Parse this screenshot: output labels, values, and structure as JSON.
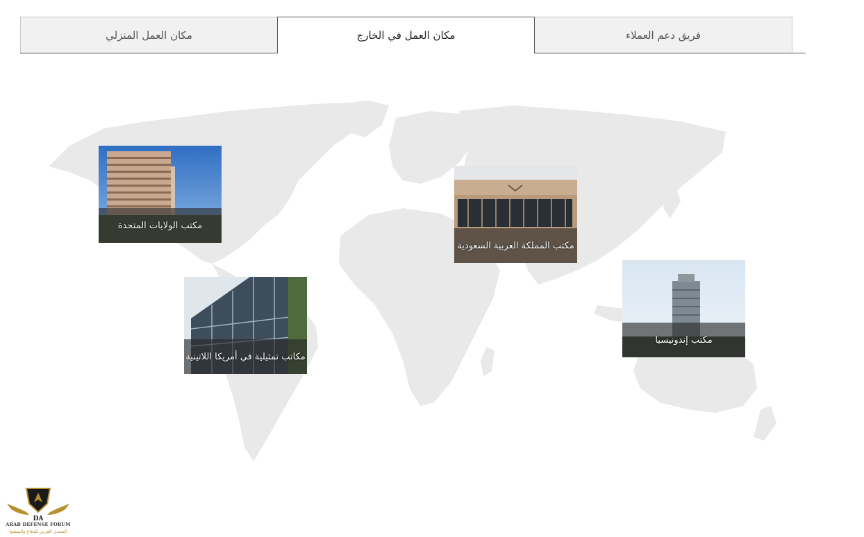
{
  "tabs": [
    {
      "id": "home",
      "label": "مكان العمل المنزلي",
      "active": false
    },
    {
      "id": "abroad",
      "label": "مكان العمل في الخارج",
      "active": true
    },
    {
      "id": "support",
      "label": "فريق دعم العملاء",
      "active": false
    }
  ],
  "offices": {
    "usa": {
      "label": "مكتب الولايات المتحدة"
    },
    "latam": {
      "label": "مكاتب تمثيلية في أمريكا اللاتينية"
    },
    "ksa": {
      "label": "مكتب المملكة العربية السعودية"
    },
    "indonesia": {
      "label": "مكتب إندونيسيا"
    }
  },
  "logo": {
    "name": "ARAB DEFENSE FORUM",
    "subtitle": "المنتدى العربي للدفاع والتسليح"
  },
  "colors": {
    "map": "#e9e9e9",
    "tab_bg": "#f1f1f1",
    "caption_bg": "rgba(40,40,40,0.62)",
    "logo_gold": "#b8912f"
  }
}
